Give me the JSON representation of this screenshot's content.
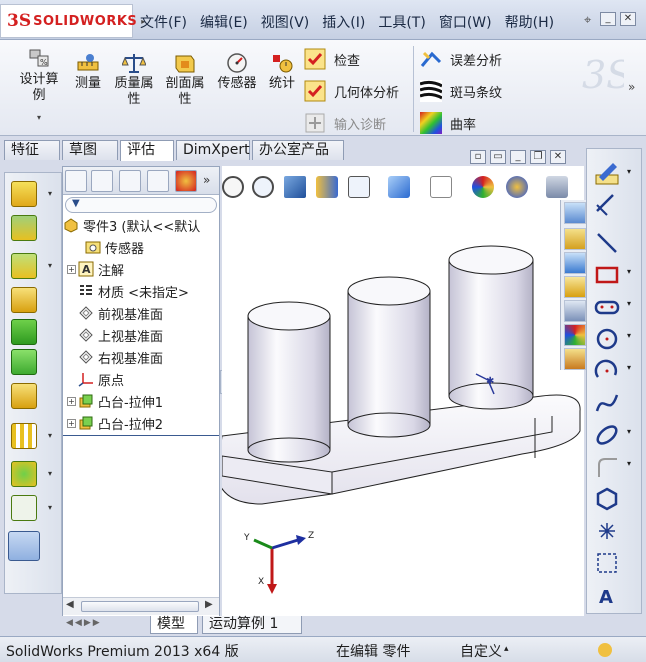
{
  "app": {
    "logo_prefix": "3S",
    "logo_text": "SOLIDWORKS",
    "brand_color": "#d42020"
  },
  "menu": [
    "文件(F)",
    "编辑(E)",
    "视图(V)",
    "插入(I)",
    "工具(T)",
    "窗口(W)",
    "帮助(H)"
  ],
  "command_manager": {
    "big_tools": [
      {
        "label_1": "设计算",
        "label_2": "例",
        "icon": "design-study-icon"
      },
      {
        "label_1": "测量",
        "label_2": "",
        "icon": "measure-icon"
      },
      {
        "label_1": "质量属",
        "label_2": "性",
        "icon": "mass-properties-icon"
      },
      {
        "label_1": "剖面属",
        "label_2": "性",
        "icon": "section-properties-icon"
      },
      {
        "label_1": "传感器",
        "label_2": "",
        "icon": "sensor-icon"
      },
      {
        "label_1": "统计",
        "label_2": "",
        "icon": "statistics-icon"
      }
    ],
    "check": "检查",
    "geometry_analysis": "几何体分析",
    "import_diagnostics": "输入诊断",
    "deviation_analysis": "误差分析",
    "zebra_stripes": "斑马条纹",
    "curvature": "曲率"
  },
  "tabs": [
    "特征",
    "草图",
    "评估",
    "DimXpert",
    "办公室产品"
  ],
  "active_tab": "评估",
  "feature_tree": {
    "root": "零件3  (默认<<默认",
    "items": [
      {
        "label": "传感器",
        "icon": "sensor-folder-icon",
        "expandable": false
      },
      {
        "label": "注解",
        "icon": "annotation-icon",
        "expandable": true
      },
      {
        "label": "材质 <未指定>",
        "icon": "material-icon",
        "expandable": false
      },
      {
        "label": "前视基准面",
        "icon": "plane-icon",
        "expandable": false
      },
      {
        "label": "上视基准面",
        "icon": "plane-icon",
        "expandable": false
      },
      {
        "label": "右视基准面",
        "icon": "plane-icon",
        "expandable": false
      },
      {
        "label": "原点",
        "icon": "origin-icon",
        "expandable": false
      },
      {
        "label": "凸台-拉伸1",
        "icon": "extrude-icon",
        "expandable": true
      },
      {
        "label": "凸台-拉伸2",
        "icon": "extrude-icon",
        "expandable": true
      }
    ]
  },
  "triad": {
    "x": "X",
    "y": "Y",
    "z": "Z"
  },
  "bottom_tabs": [
    "模型",
    "运动算例 1"
  ],
  "status": {
    "product": "SolidWorks Premium 2013 x64 版",
    "mode": "在编辑 零件",
    "custom": "自定义"
  }
}
